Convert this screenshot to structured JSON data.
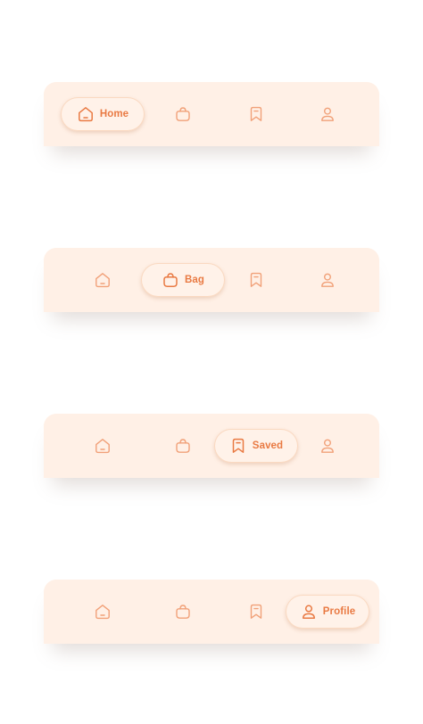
{
  "navbars": [
    {
      "active_label": "Home"
    },
    {
      "active_label": "Bag"
    },
    {
      "active_label": "Saved"
    },
    {
      "active_label": "Profile"
    }
  ],
  "icons": {
    "home": "home-icon",
    "bag": "bag-icon",
    "saved": "bookmark-icon",
    "profile": "profile-icon"
  },
  "colors": {
    "bar_background": "#fff0e6",
    "accent": "#e97a43",
    "icon_muted": "#f1a179"
  }
}
